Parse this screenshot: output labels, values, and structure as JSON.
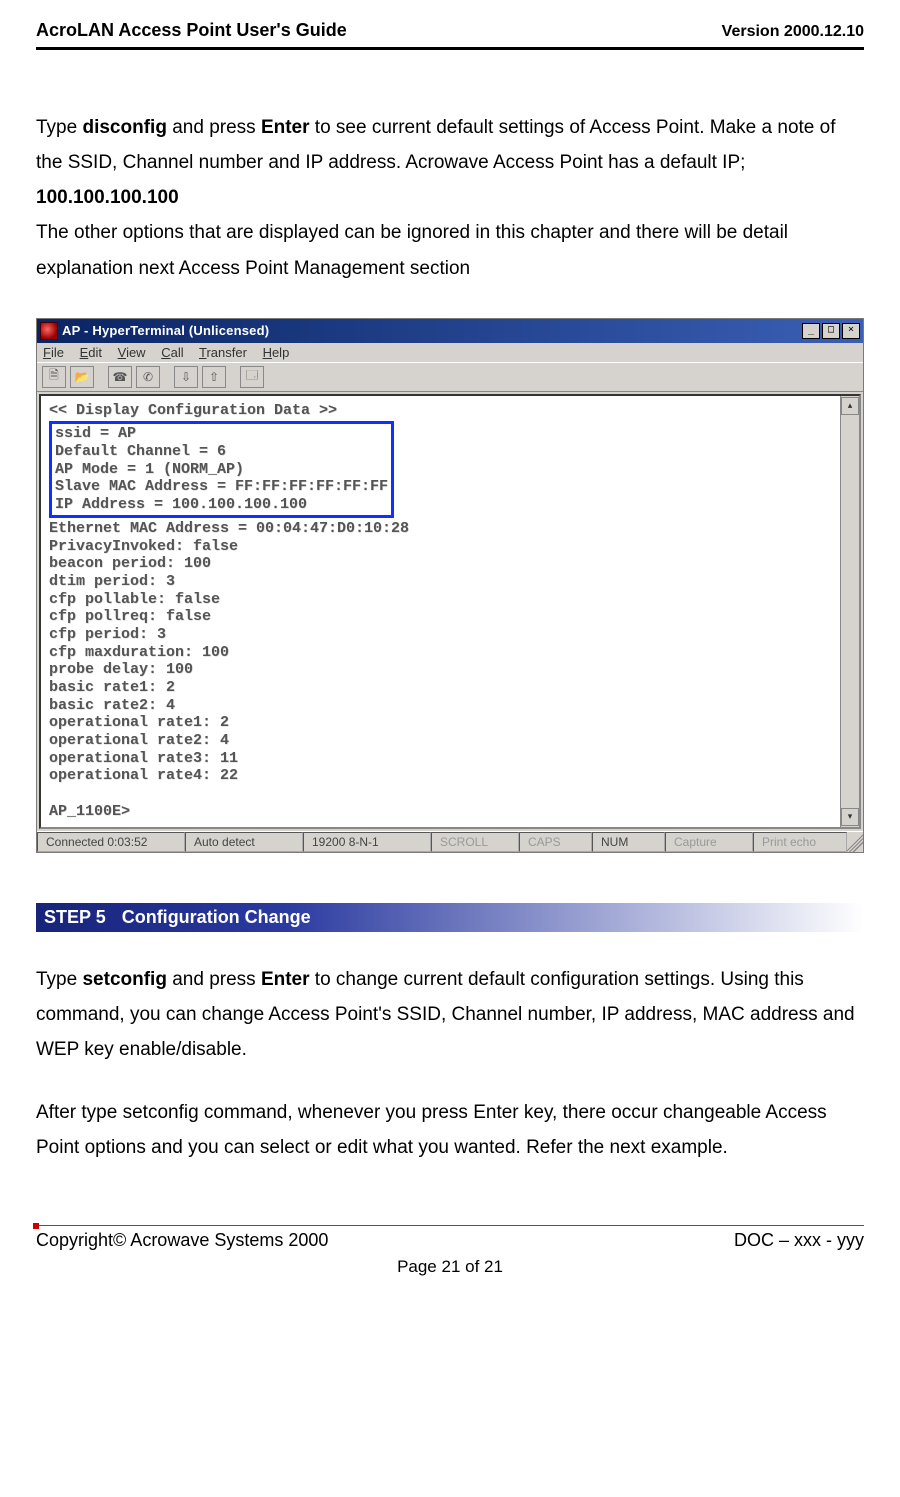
{
  "header": {
    "title": "AcroLAN Access Point User's Guide",
    "version": "Version 2000.12.10"
  },
  "para1": {
    "pre1": "Type ",
    "cmd": "disconfig",
    "mid1": " and press ",
    "key": "Enter",
    "mid2": " to see current default settings of Access Point. Make a note of the SSID, Channel number and IP address. Acrowave Access Point has a default IP; ",
    "ip": "100.100.100.100"
  },
  "para1b": "The other options that are displayed can be ignored in this chapter and there will be detail explanation next Access Point Management section",
  "window": {
    "title": "AP - HyperTerminal (Unlicensed)",
    "menu": {
      "file": "File",
      "edit": "Edit",
      "view": "View",
      "call": "Call",
      "transfer": "Transfer",
      "help": "Help"
    },
    "status": {
      "conn": "Connected 0:03:52",
      "detect": "Auto detect",
      "baud": "19200 8-N-1",
      "scroll": "SCROLL",
      "caps": "CAPS",
      "num": "NUM",
      "capture": "Capture",
      "echo": "Print echo"
    },
    "term": {
      "header": "<< Display Configuration Data >>",
      "highlight": "ssid = AP\nDefault Channel = 6\nAP Mode = 1 (NORM_AP)\nSlave MAC Address = FF:FF:FF:FF:FF:FF\nIP Address = 100.100.100.100",
      "rest": "Ethernet MAC Address = 00:04:47:D0:10:28\nPrivacyInvoked: false\nbeacon period: 100\ndtim period: 3\ncfp pollable: false\ncfp pollreq: false\ncfp period: 3\ncfp maxduration: 100\nprobe delay: 100\nbasic rate1: 2\nbasic rate2: 4\noperational rate1: 2\noperational rate2: 4\noperational rate3: 11\noperational rate4: 22\n\nAP_1100E>"
    }
  },
  "step": {
    "num": "STEP 5",
    "title": "Configuration Change"
  },
  "para2": {
    "pre1": "Type ",
    "cmd": "setconfig",
    "mid1": " and press ",
    "key": "Enter",
    "rest": " to change current default configuration settings. Using this command, you can change Access Point's SSID, Channel number, IP address, MAC address and WEP key enable/disable."
  },
  "para3": "After type setconfig command, whenever you press Enter key, there occur changeable Access Point options and you can select or edit what you wanted. Refer the next example.",
  "footer": {
    "left": "Copyright© Acrowave Systems 2000",
    "right": "DOC – xxx - yyy",
    "page": "Page 21 of 21"
  }
}
